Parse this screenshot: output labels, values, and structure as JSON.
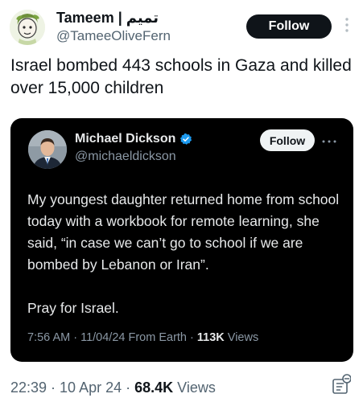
{
  "outer_tweet": {
    "display_name": "Tameem | تميم",
    "handle": "@TameeOliveFern",
    "follow_label": "Follow",
    "text": "Israel bombed 443 schools in Gaza and killed over 15,000 children",
    "timestamp": "22:39 · 10 Apr 24 · ",
    "views_count": "68.4K",
    "views_label": " Views",
    "avatar_icon": "olive-character-avatar-icon",
    "more_icon": "vertical-dots-icon",
    "analytics_icon": "analytics-icon"
  },
  "quoted_tweet": {
    "display_name": "Michael Dickson",
    "verified_icon": "verified-badge-icon",
    "handle": "@michaeldickson",
    "follow_label": "Follow",
    "more_icon": "horizontal-dots-icon",
    "avatar_icon": "profile-photo-avatar-icon",
    "paragraph_1": "My youngest daughter returned home from school today with a workbook for remote learning, she said, “in case we can’t go to school if we are bombed by Lebanon or Iran”.",
    "paragraph_2": "Pray for Israel.",
    "meta": "7:56 AM · 11/04/24 From Earth · ",
    "views_count": "113K",
    "views_label": " Views"
  },
  "colors": {
    "text_primary": "#0f1419",
    "text_secondary": "#536471",
    "card_background": "#000000",
    "card_text": "#e7e9ea",
    "card_secondary": "#8b98a5",
    "verified_blue": "#1d9bf0"
  }
}
